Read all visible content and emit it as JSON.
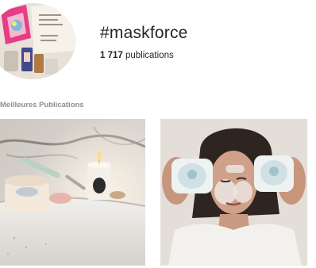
{
  "header": {
    "hashtag": "#maskforce",
    "publication_count": "1 717",
    "publication_label": "publications"
  },
  "sections": {
    "top_posts_label": "Meilleures Publications"
  },
  "posts": [
    {
      "type": "photo",
      "subject": "skincare jar on bathroom tub with jade roller and candle"
    },
    {
      "type": "photo",
      "subject": "woman holding two mask jars over eyes"
    }
  ]
}
